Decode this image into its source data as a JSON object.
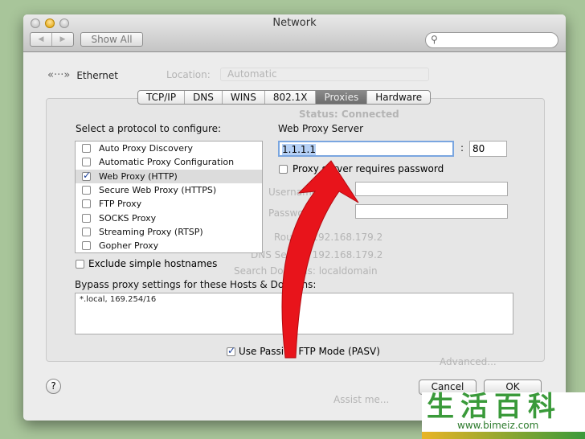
{
  "window": {
    "title": "Network",
    "show_all": "Show All",
    "nav_back": "◀",
    "nav_fwd": "▶",
    "search_placeholder": ""
  },
  "background": {
    "location_label": "Location:",
    "location_value": "Automatic",
    "status_label": "Status:",
    "status_value": "Connected",
    "advanced": "Advanced...",
    "assist": "Assist me...",
    "router": "Router: 192.168.179.2",
    "dns": "DNS Server: 192.168.179.2",
    "search_domains": "Search Domains: localdomain"
  },
  "service": {
    "name": "Ethernet",
    "icon": "ethernet-icon"
  },
  "tabs": [
    {
      "label": "TCP/IP"
    },
    {
      "label": "DNS"
    },
    {
      "label": "WINS"
    },
    {
      "label": "802.1X"
    },
    {
      "label": "Proxies",
      "selected": true
    },
    {
      "label": "Hardware"
    }
  ],
  "proxies": {
    "select_label": "Select a protocol to configure:",
    "protocols": [
      {
        "label": "Auto Proxy Discovery",
        "checked": false
      },
      {
        "label": "Automatic Proxy Configuration",
        "checked": false
      },
      {
        "label": "Web Proxy (HTTP)",
        "checked": true
      },
      {
        "label": "Secure Web Proxy (HTTPS)",
        "checked": false
      },
      {
        "label": "FTP Proxy",
        "checked": false
      },
      {
        "label": "SOCKS Proxy",
        "checked": false
      },
      {
        "label": "Streaming Proxy (RTSP)",
        "checked": false
      },
      {
        "label": "Gopher Proxy",
        "checked": false
      }
    ],
    "server_label": "Web Proxy Server",
    "server_value": "1.1.1.1",
    "colon": ":",
    "port_value": "80",
    "requires_password": "Proxy server requires password",
    "username_label": "Username:",
    "password_label": "Password:",
    "exclude_simple": "Exclude simple hostnames",
    "bypass_label": "Bypass proxy settings for these Hosts & Domains:",
    "bypass_value": "*.local, 169.254/16",
    "passive_ftp": "Use Passive FTP Mode (PASV)"
  },
  "buttons": {
    "help": "?",
    "cancel": "Cancel",
    "ok": "OK"
  },
  "colors": {
    "annotation_arrow": "#e8141b",
    "selected_tab": "#7a7a7a",
    "background": "#a8c59a"
  },
  "watermark": {
    "text": "生活百科",
    "url": "www.bimeiz.com"
  }
}
